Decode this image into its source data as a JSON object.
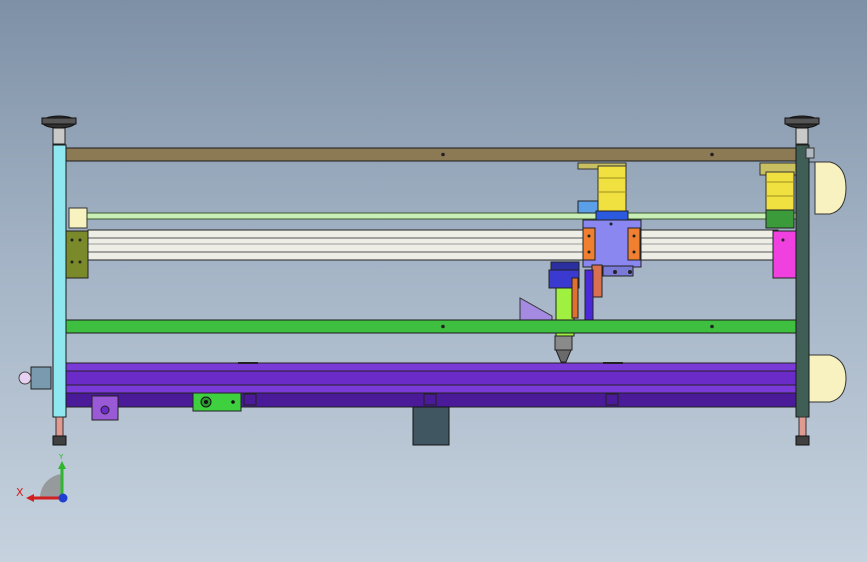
{
  "viewport": {
    "background_top": "#7e90a6",
    "background_bottom": "#c6d2de"
  },
  "colors": {
    "frame_outline": "#1a1a1a",
    "top_rail": "#8b7a54",
    "left_post": "#8fe7ef",
    "right_post": "#3e5e56",
    "green_rail": "#3fbf3f",
    "purple_bed": "#6a2bc8",
    "purple_bed_dark": "#4b1a98",
    "yellow_guard": "#f7f2c0",
    "motor_yellow": "#f0e040",
    "carriage_blue": "#8a88f0",
    "orange_block": "#f08030",
    "magenta_block": "#f040e0",
    "olive_block": "#7a8a2a",
    "gray_box": "#405660",
    "axis_x": "#d21f1f",
    "axis_y": "#2fb52f",
    "axis_z": "#1f3fd2"
  },
  "icons": {
    "view_triad": "axis-triad-icon"
  },
  "triad": {
    "x_label": "X",
    "y_label": "Y"
  }
}
